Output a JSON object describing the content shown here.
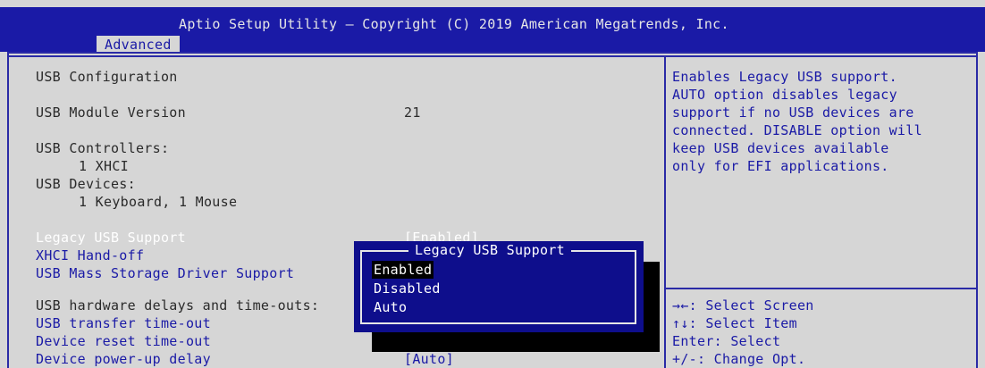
{
  "header": {
    "title": "Aptio Setup Utility – Copyright (C) 2019 American Megatrends, Inc.",
    "tab": "Advanced"
  },
  "main": {
    "section_title": "USB Configuration",
    "module_version_label": "USB Module Version",
    "module_version_value": "21",
    "controllers_label": "USB Controllers:",
    "controllers_value": "1 XHCI",
    "devices_label": "USB Devices:",
    "devices_value": "1 Keyboard, 1 Mouse",
    "settings": [
      {
        "label": "Legacy USB Support",
        "value": "[Enabled]"
      },
      {
        "label": "XHCI Hand-off",
        "value": ""
      },
      {
        "label": "USB Mass Storage Driver Support",
        "value": ""
      }
    ],
    "delays_heading": "USB hardware delays and time-outs:",
    "timeouts": [
      {
        "label": "USB transfer time-out",
        "value": ""
      },
      {
        "label": "Device reset time-out",
        "value": ""
      },
      {
        "label": "Device power-up delay",
        "value": "[Auto]"
      }
    ]
  },
  "help": {
    "lines": [
      "Enables Legacy USB support.",
      "AUTO option disables legacy",
      "support if no USB devices are",
      "connected. DISABLE option will",
      "keep USB devices available",
      "only for EFI applications."
    ]
  },
  "keys": [
    "→←: Select Screen",
    "↑↓: Select Item",
    "Enter: Select",
    "+/-: Change Opt."
  ],
  "popup": {
    "title": "Legacy USB Support",
    "options": [
      "Enabled",
      "Disabled",
      "Auto"
    ],
    "selected": "Enabled"
  },
  "colors": {
    "background": "#d6d6d6",
    "header": "#1a1aa6",
    "popup": "#0e0e8c",
    "highlight_text": "#ffffff"
  }
}
